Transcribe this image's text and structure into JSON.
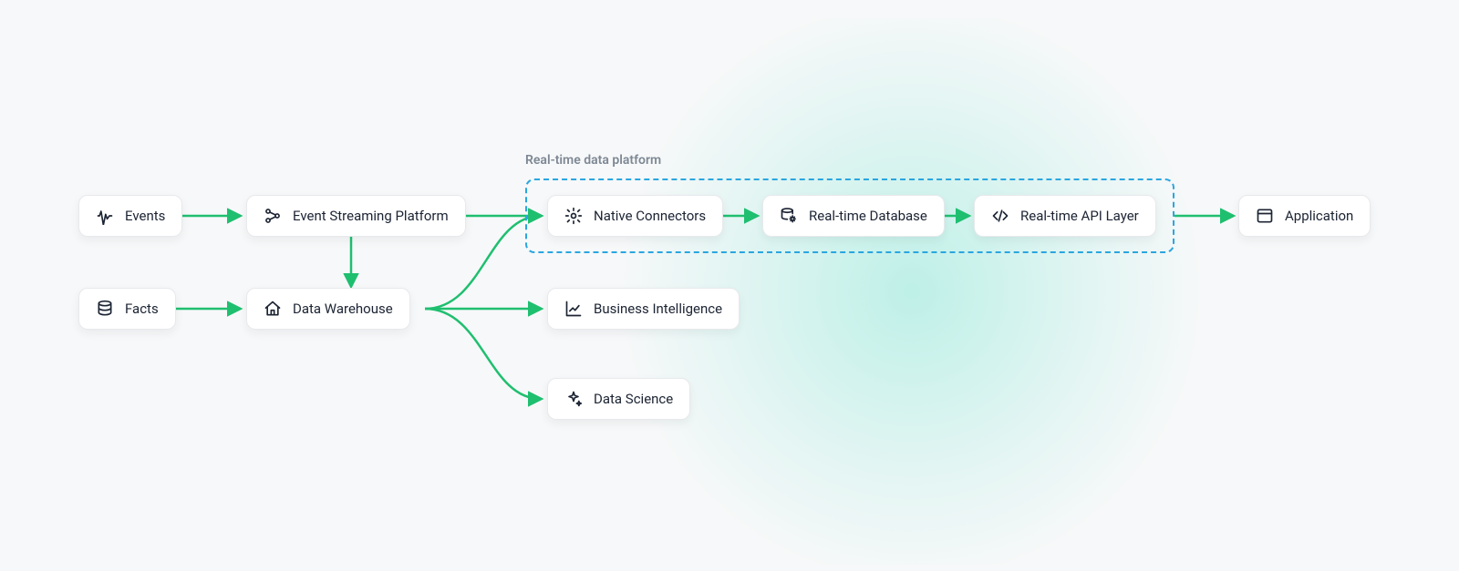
{
  "colors": {
    "arrow": "#1fbf70",
    "platform_border": "#2aa6e0",
    "label": "#7d8894",
    "node_text": "#1c2433"
  },
  "platform": {
    "label": "Real-time data platform"
  },
  "nodes": {
    "events": {
      "label": "Events",
      "icon": "waveform-icon"
    },
    "facts": {
      "label": "Facts",
      "icon": "database-icon"
    },
    "event_streaming": {
      "label": "Event Streaming Platform",
      "icon": "nodes-icon"
    },
    "data_warehouse": {
      "label": "Data Warehouse",
      "icon": "home-icon"
    },
    "native_connectors": {
      "label": "Native Connectors",
      "icon": "gear-icon"
    },
    "realtime_db": {
      "label": "Real-time Database",
      "icon": "database-gear-icon"
    },
    "realtime_api": {
      "label": "Real-time API Layer",
      "icon": "code-icon"
    },
    "business_intelligence": {
      "label": "Business Intelligence",
      "icon": "chart-icon"
    },
    "data_science": {
      "label": "Data Science",
      "icon": "sparkle-icon"
    },
    "application": {
      "label": "Application",
      "icon": "window-icon"
    }
  },
  "edges": [
    {
      "from": "events",
      "to": "event_streaming"
    },
    {
      "from": "facts",
      "to": "data_warehouse"
    },
    {
      "from": "event_streaming",
      "to": "data_warehouse"
    },
    {
      "from": "event_streaming",
      "to": "native_connectors"
    },
    {
      "from": "data_warehouse",
      "to": "native_connectors"
    },
    {
      "from": "data_warehouse",
      "to": "business_intelligence"
    },
    {
      "from": "data_warehouse",
      "to": "data_science"
    },
    {
      "from": "native_connectors",
      "to": "realtime_db"
    },
    {
      "from": "realtime_db",
      "to": "realtime_api"
    },
    {
      "from": "realtime_api",
      "to": "application"
    }
  ]
}
